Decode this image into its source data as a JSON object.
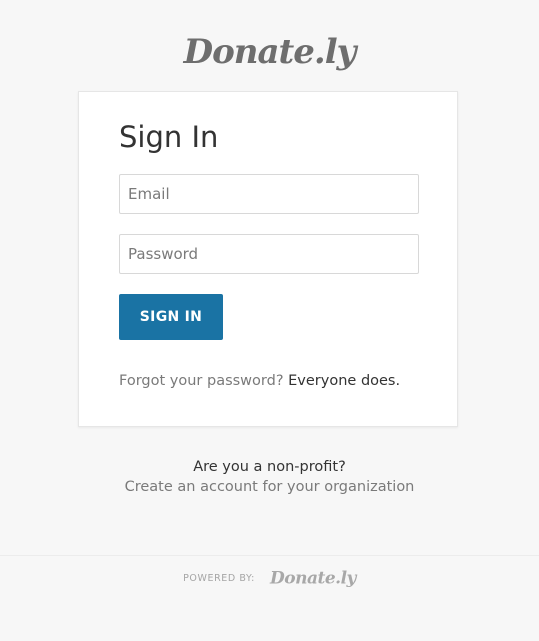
{
  "header": {
    "logo_text": "Donate.ly"
  },
  "signin_card": {
    "title": "Sign In",
    "email_placeholder": "Email",
    "email_value": "",
    "password_placeholder": "Password",
    "password_value": "",
    "submit_label": "SIGN IN",
    "forgot_question": "Forgot your password?",
    "forgot_link": "Everyone does."
  },
  "nonprofit": {
    "question": "Are you a non-profit?",
    "create_link": "Create an account for your organization"
  },
  "footer": {
    "powered_by": "POWERED BY:",
    "logo_text": "Donate.ly"
  },
  "colors": {
    "background": "#f7f7f7",
    "card": "#ffffff",
    "primary_button": "#1a73a4",
    "muted_text": "#7a7a7a",
    "dark_text": "#333333",
    "logo": "#6e6e6e"
  }
}
